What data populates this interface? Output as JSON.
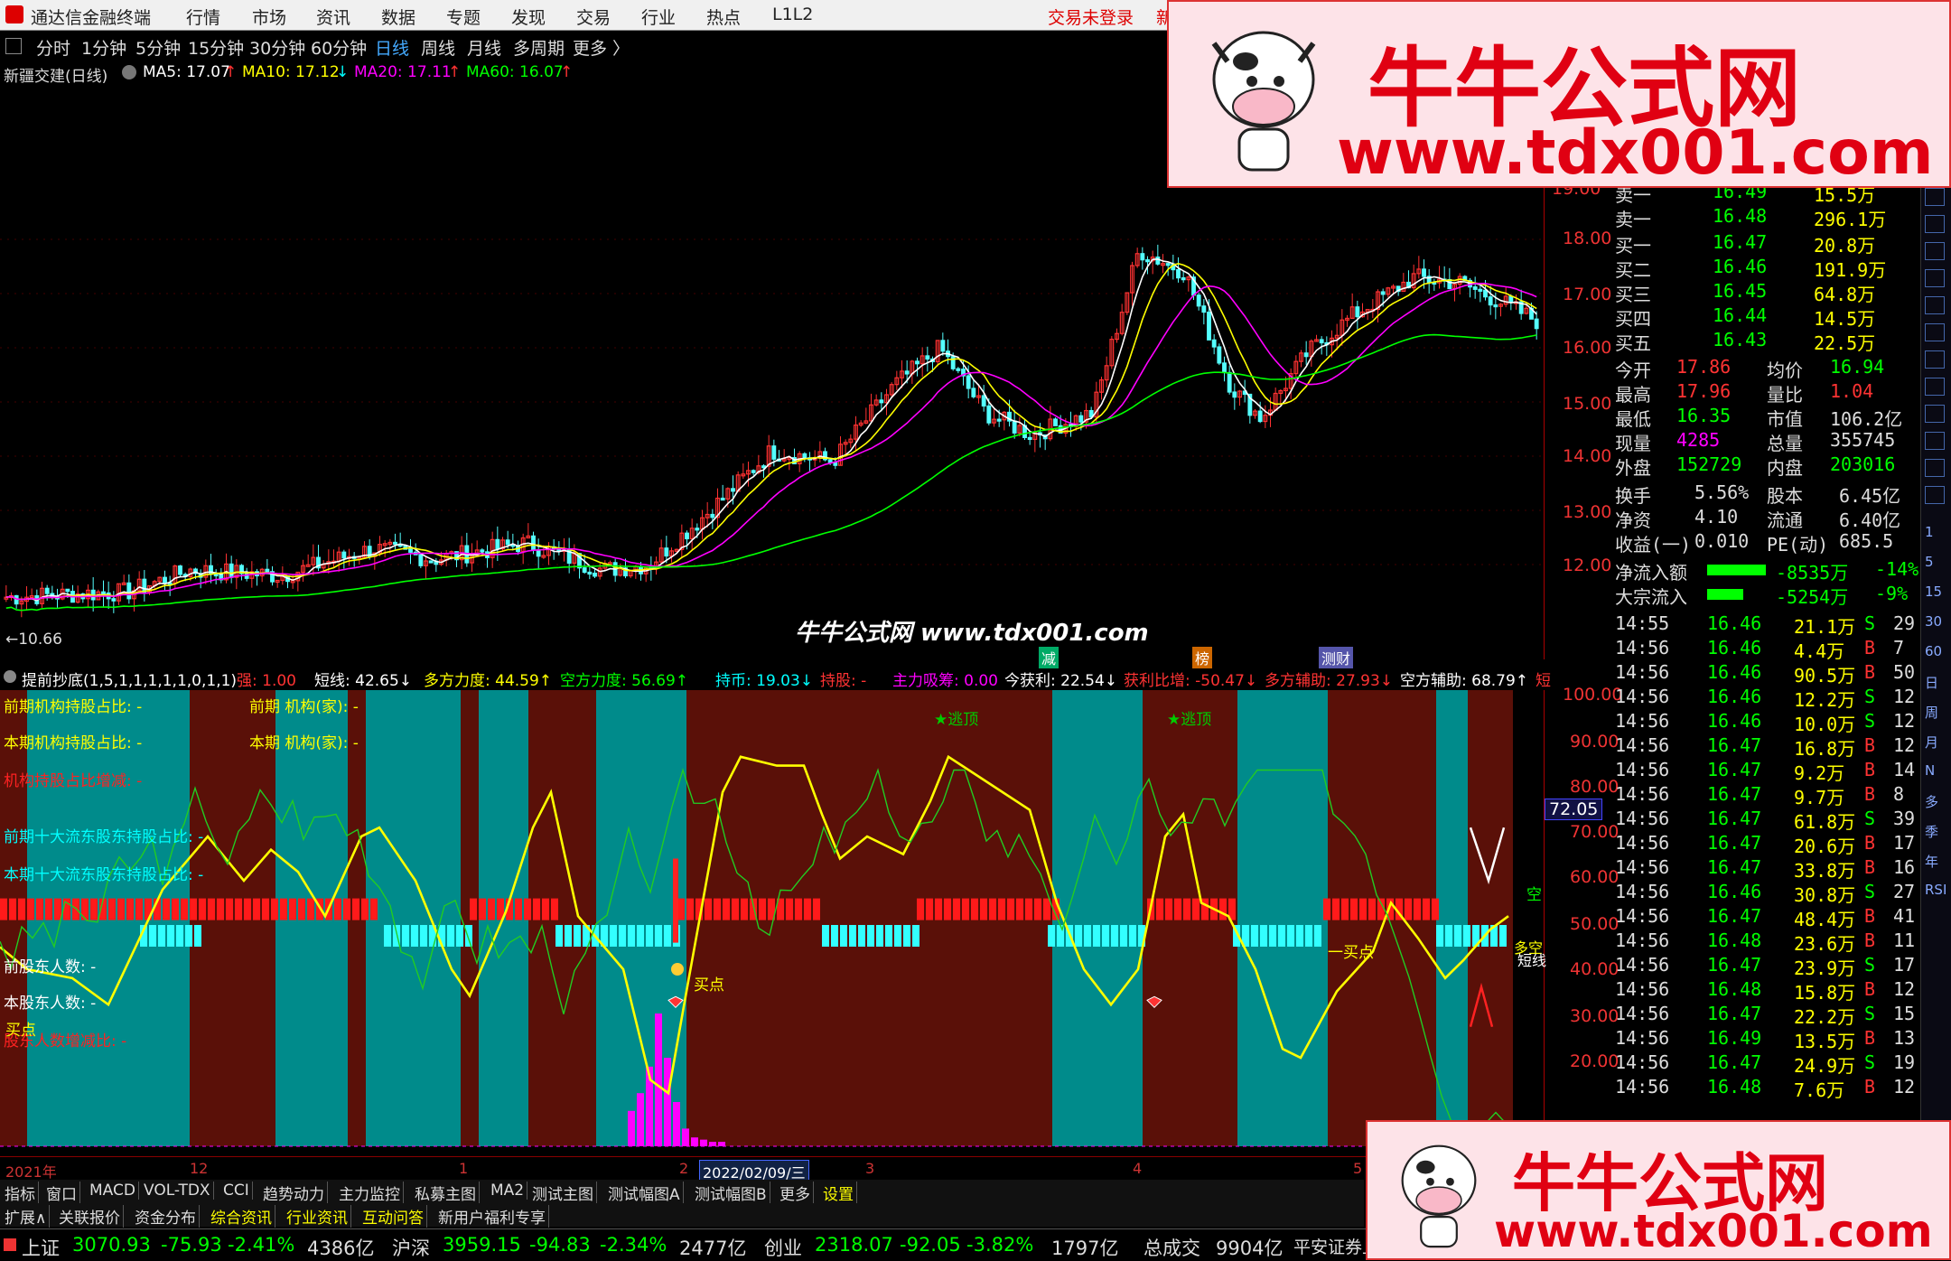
{
  "menu": {
    "app": "通达信金融终端",
    "items": [
      "行情",
      "市场",
      "资讯",
      "数据",
      "专题",
      "发现",
      "交易",
      "行业",
      "热点",
      "L1L2"
    ],
    "login": "交易未登录",
    "extra": "新"
  },
  "periods": [
    "分时",
    "1分钟",
    "5分钟",
    "15分钟",
    "30分钟",
    "60分钟",
    "日线",
    "周线",
    "月线",
    "多周期",
    "更多 〉"
  ],
  "ma_legend": {
    "stock": "新疆交建(日线)",
    "ma5": "MA5: 17.07",
    "ma10": "MA10: 17.12",
    "ma20": "MA20: 17.11",
    "ma60": "MA60: 16.07",
    "ma5_arrow": "↑",
    "ma10_arrow": "↓",
    "ma20_arrow": "↑",
    "ma60_arrow": "↑"
  },
  "kchart": {
    "price_ticks": [
      "18.00",
      "17.00",
      "16.00",
      "15.00",
      "14.00",
      "13.00",
      "12.00"
    ],
    "top_tick": "19.00",
    "low_label": "←10.66",
    "badges": [
      "减",
      "榜",
      "测财"
    ]
  },
  "indicator": {
    "name": "提前抄底(1,5,1,1,1,1,1,0,1,1)",
    "items": [
      "强: 1.00",
      "短线: 42.65↓",
      "多方力度: 44.59↑",
      "空方力度: 56.69↑",
      "持币: 19.03↓",
      "持股: -",
      "主力吸筹: 0.00",
      "今获利: 22.54↓",
      "获利比增: -50.47↓",
      "多方辅助: 27.93↓",
      "空方辅助: 68.79↑",
      "短"
    ],
    "left_labels": [
      "前期机构持股占比: -",
      "本期机构持股占比: -",
      "机构持股占比增减: -",
      "前期十大流东股东持股占比: -",
      "本期十大流东股东持股占比: -",
      "前股东人数: -",
      "本股东人数: -",
      "股东人数增减比: -"
    ],
    "mid_labels": [
      "前期 机构(家): -",
      "本期 机构(家): -"
    ],
    "axis": [
      "100.00",
      "90.00",
      "80.00",
      "70.00",
      "60.00",
      "50.00",
      "40.00",
      "30.00",
      "20.00"
    ],
    "cursor_value": "72.05",
    "annotations": {
      "escape": "★逃顶",
      "buy": "买点",
      "buy2": "一买点",
      "empty": "空",
      "multi": "多空",
      "short": "短线"
    }
  },
  "date_axis": {
    "items": [
      "2021年",
      "12",
      "1",
      "2",
      "2022/02/09/三",
      "3",
      "4",
      "5"
    ]
  },
  "tabs1": [
    "指标",
    "窗口",
    "MACD",
    "VOL-TDX",
    "CCI",
    "趋势动力",
    "主力监控",
    "私募主图",
    "MA2",
    "测试主图",
    "测试幅图A",
    "测试幅图B",
    "更多",
    "设置"
  ],
  "tabs2": [
    "扩展∧",
    "关联报价",
    "资金分布",
    "综合资讯",
    "行业资讯",
    "互动问答",
    "新用户福利专享"
  ],
  "index_bar": {
    "sh_name": "上证",
    "sh_val": "3070.93",
    "sh_chg": "-75.93",
    "sh_pct": "-2.41%",
    "sh_amt": "4386亿",
    "sz_name": "沪深",
    "sz_val": "3959.15",
    "sz_chg": "-94.83",
    "sz_pct": "-2.34%",
    "sz_amt": "2477亿",
    "cy_name": "创业",
    "cy_val": "2318.07",
    "cy_chg": "-92.05",
    "cy_pct": "-3.82%",
    "cy_amt": "1797亿",
    "total_label": "总成交",
    "total_amt": "9904亿",
    "broker": "平安证券上"
  },
  "quote": {
    "asks": [
      [
        "卖一",
        "16.49",
        "15.5万"
      ],
      [
        "卖一",
        "16.48",
        "296.1万"
      ]
    ],
    "bids": [
      [
        "买一",
        "16.47",
        "20.8万"
      ],
      [
        "买二",
        "16.46",
        "191.9万"
      ],
      [
        "买三",
        "16.45",
        "64.8万"
      ],
      [
        "买四",
        "16.44",
        "14.5万"
      ],
      [
        "买五",
        "16.43",
        "22.5万"
      ]
    ],
    "stats": [
      [
        "今开",
        "17.86",
        "均价",
        "16.94"
      ],
      [
        "最高",
        "17.96",
        "量比",
        "1.04"
      ],
      [
        "最低",
        "16.35",
        "市值",
        "106.2亿"
      ],
      [
        "现量",
        "4285",
        "总量",
        "355745"
      ],
      [
        "外盘",
        "152729",
        "内盘",
        "203016"
      ]
    ],
    "fund": [
      [
        "换手",
        "5.56%",
        "股本",
        "6.45亿"
      ],
      [
        "净资",
        "4.10",
        "流通",
        "6.40亿"
      ],
      [
        "收益(一)",
        "0.010",
        "PE(动)",
        "685.5"
      ]
    ],
    "flow": [
      [
        "净流入额",
        "-8535万",
        "-14%"
      ],
      [
        "大宗流入",
        "-5254万",
        "-9%"
      ]
    ],
    "ticks": [
      [
        "14:55",
        "16.46",
        "21.1万",
        "S",
        "29"
      ],
      [
        "14:56",
        "16.46",
        "4.4万",
        "B",
        "7"
      ],
      [
        "14:56",
        "16.46",
        "90.5万",
        "B",
        "50"
      ],
      [
        "14:56",
        "16.46",
        "12.2万",
        "S",
        "12"
      ],
      [
        "14:56",
        "16.46",
        "10.0万",
        "S",
        "12"
      ],
      [
        "14:56",
        "16.47",
        "16.8万",
        "B",
        "12"
      ],
      [
        "14:56",
        "16.47",
        "9.2万",
        "B",
        "14"
      ],
      [
        "14:56",
        "16.47",
        "9.7万",
        "B",
        "8"
      ],
      [
        "14:56",
        "16.47",
        "61.8万",
        "S",
        "39"
      ],
      [
        "14:56",
        "16.47",
        "20.6万",
        "B",
        "17"
      ],
      [
        "14:56",
        "16.47",
        "33.8万",
        "B",
        "16"
      ],
      [
        "14:56",
        "16.46",
        "30.8万",
        "S",
        "27"
      ],
      [
        "14:56",
        "16.47",
        "48.4万",
        "B",
        "41"
      ],
      [
        "14:56",
        "16.48",
        "23.6万",
        "B",
        "11"
      ],
      [
        "14:56",
        "16.47",
        "23.9万",
        "S",
        "17"
      ],
      [
        "14:56",
        "16.48",
        "15.8万",
        "B",
        "12"
      ],
      [
        "14:56",
        "16.47",
        "22.2万",
        "S",
        "15"
      ],
      [
        "14:56",
        "16.49",
        "13.5万",
        "B",
        "13"
      ],
      [
        "14:56",
        "16.47",
        "24.9万",
        "S",
        "19"
      ],
      [
        "14:56",
        "16.48",
        "7.6万",
        "B",
        "12"
      ]
    ]
  },
  "toolstrip": [
    "1",
    "5",
    "15",
    "30",
    "60",
    "日",
    "周",
    "月",
    "N",
    "多",
    "季",
    "年",
    "RSI"
  ],
  "watermark": {
    "cn": "牛牛公式网",
    "url": "www.tdx001.com",
    "mid": "牛牛公式网 www.tdx001.com"
  },
  "colors": {
    "up": "#ff3232",
    "down": "#54ffff",
    "ma5": "#ffffff",
    "ma10": "#ffff00",
    "ma20": "#ff00ff",
    "ma60": "#00ff00",
    "teal": "#008b8b",
    "maroon": "#5a1008",
    "yellow_label": "#ffff00",
    "red": "#ff2020"
  }
}
